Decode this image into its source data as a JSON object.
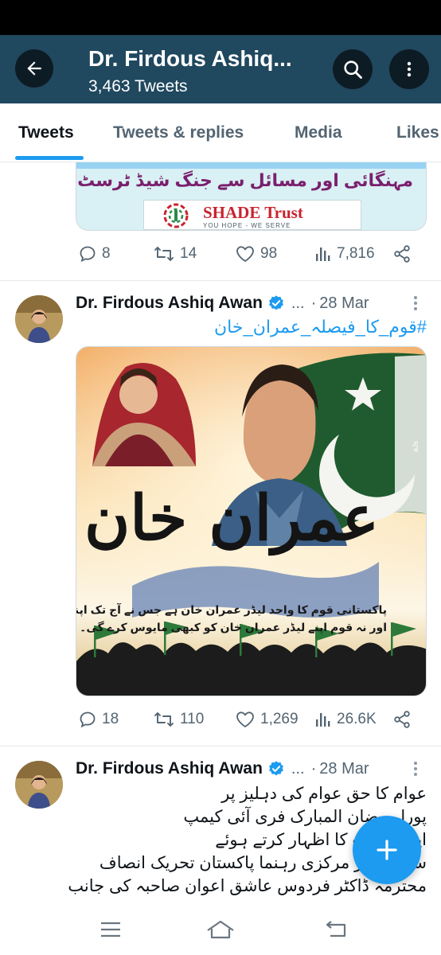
{
  "header": {
    "title": "Dr. Firdous Ashiq...",
    "subtitle": "3,463 Tweets",
    "background": "#20485f"
  },
  "tabs": [
    {
      "label": "Tweets",
      "active": true
    },
    {
      "label": "Tweets & replies",
      "active": false
    },
    {
      "label": "Media",
      "active": false
    },
    {
      "label": "Likes",
      "active": false
    }
  ],
  "prev_tweet": {
    "banner_text": "مہنگائی اور مسائل سے جنگ شیڈ ٹرسٹ کے سنگ",
    "logo_name": "SHADE Trust",
    "logo_tagline": "YOU HOPE - WE SERVE",
    "stats": {
      "replies": "8",
      "retweets": "14",
      "likes": "98",
      "views": "7,816"
    }
  },
  "tweets": [
    {
      "author": "Dr. Firdous Ashiq Awan",
      "handle": "...",
      "separator": "·",
      "date": "28 Mar",
      "hashtag": "#قوم_کا_فیصلہ_عمران_خان",
      "image": {
        "calligraphy": "عمران خان",
        "caption_line1": "پاکستانی قوم کا واحد لیڈر عمران خان ہے جس نے آج تک اپنی قوم کو مایوس نہیں کیا",
        "caption_line2": "اور نہ قوم اپنے لیڈر عمران خان کو کبھی مایوس کرے گی۔",
        "watermark": "aJs"
      },
      "stats": {
        "replies": "18",
        "retweets": "110",
        "likes": "1,269",
        "views": "26.6K"
      }
    },
    {
      "author": "Dr. Firdous Ashiq Awan",
      "handle": "...",
      "separator": "·",
      "date": "28 Mar",
      "lines": [
        "عوام کا حق عوام کی دہلیز پر",
        "پورا رمضان المبارک فری آئی کیمپ",
        "اپنے خیالات کا اظہار کرتے ہوئے",
        "سابق وزیر مرکزی رہنما پاکستان تحریک انصاف",
        "محترمہ ڈاکٹر فردوس عاشق اعوان صاحبہ کی جانب"
      ]
    }
  ],
  "colors": {
    "accent": "#1d9bf0",
    "muted": "#536471"
  },
  "icons": [
    "back-arrow-icon",
    "search-icon",
    "more-vertical-icon",
    "reply-icon",
    "retweet-icon",
    "like-icon",
    "views-icon",
    "share-icon",
    "verified-badge-icon",
    "compose-plus-icon",
    "menu-icon",
    "home-icon",
    "back-nav-icon"
  ]
}
